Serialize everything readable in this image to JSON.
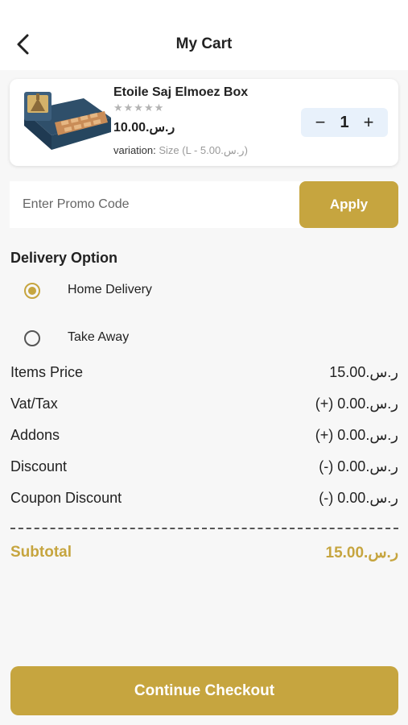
{
  "header": {
    "title": "My Cart",
    "back_icon": "chevron-left-icon"
  },
  "cart_item": {
    "name": "Etoile Saj Elmoez Box",
    "stars": "★★★★★",
    "rating": 0,
    "price": "10.00.ر.س",
    "variation_label": "variation:",
    "variation_value": "Size (L - 5.00.ر.س)",
    "quantity": "1",
    "minus": "−",
    "plus": "+"
  },
  "promo": {
    "placeholder": "Enter Promo Code",
    "apply_label": "Apply"
  },
  "delivery": {
    "title": "Delivery Option",
    "options": [
      {
        "label": "Home Delivery",
        "selected": true
      },
      {
        "label": "Take Away",
        "selected": false
      }
    ]
  },
  "summary": [
    {
      "label": "Items Price",
      "amount": "15.00.ر.س"
    },
    {
      "label": "Vat/Tax",
      "amount": "(+) 0.00.ر.س"
    },
    {
      "label": "Addons",
      "amount": "(+) 0.00.ر.س"
    },
    {
      "label": "Discount",
      "amount": "(-) 0.00.ر.س"
    },
    {
      "label": "Coupon Discount",
      "amount": "(-) 0.00.ر.س"
    }
  ],
  "subtotal": {
    "label": "Subtotal",
    "amount": "15.00.ر.س"
  },
  "checkout_label": "Continue Checkout",
  "colors": {
    "accent": "#c6a53f",
    "qty_bg": "#e8f1fb",
    "background": "#f7f7f7"
  }
}
